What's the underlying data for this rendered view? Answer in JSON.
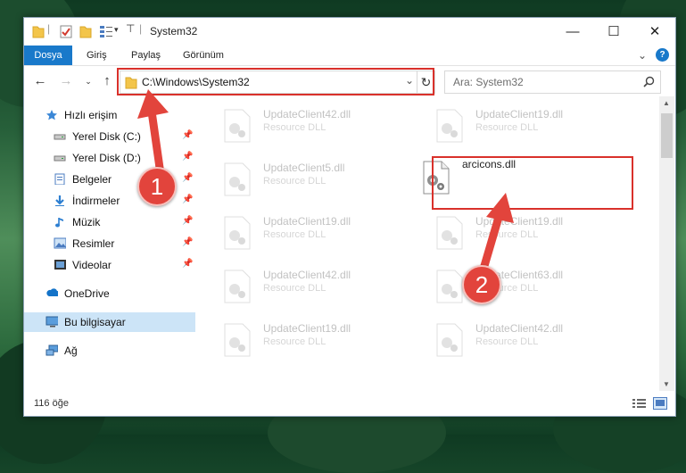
{
  "window": {
    "title": "System32",
    "minimize_label": "—",
    "maximize_label": "☐",
    "close_label": "✕"
  },
  "ribbon": {
    "tabs": [
      "Dosya",
      "Giriş",
      "Paylaş",
      "Görünüm"
    ],
    "collapse_label": "⌄",
    "help_label": "?"
  },
  "address": {
    "path": "C:\\Windows\\System32",
    "dropdown_label": "⌄",
    "refresh_label": "↻"
  },
  "search": {
    "placeholder": "Ara: System32",
    "icon": "search-icon"
  },
  "sidebar": {
    "items": [
      {
        "label": "Hızlı erişim",
        "icon": "star-icon",
        "pinned": false
      },
      {
        "label": "Yerel Disk (C:)",
        "icon": "drive-icon",
        "pinned": true
      },
      {
        "label": "Yerel Disk (D:)",
        "icon": "drive-icon",
        "pinned": true
      },
      {
        "label": "Belgeler",
        "icon": "documents-icon",
        "pinned": true
      },
      {
        "label": "İndirmeler",
        "icon": "download-icon",
        "pinned": true
      },
      {
        "label": "Müzik",
        "icon": "music-icon",
        "pinned": true
      },
      {
        "label": "Resimler",
        "icon": "pictures-icon",
        "pinned": true
      },
      {
        "label": "Videolar",
        "icon": "videos-icon",
        "pinned": true
      },
      {
        "label": "OneDrive",
        "icon": "cloud-icon",
        "pinned": false
      },
      {
        "label": "Bu bilgisayar",
        "icon": "computer-icon",
        "pinned": false
      },
      {
        "label": "Ağ",
        "icon": "network-icon",
        "pinned": false
      }
    ],
    "pin_glyph": "📌"
  },
  "files": {
    "left": [
      {
        "name": "UpdateClient42.dll",
        "type": "Resource DLL"
      },
      {
        "name": "UpdateClient5.dll",
        "type": "Resource DLL"
      },
      {
        "name": "UpdateClient19.dll",
        "type": "Resource DLL"
      },
      {
        "name": "UpdateClient42.dll",
        "type": "Resource DLL"
      },
      {
        "name": "UpdateClient19.dll",
        "type": "Resource DLL"
      }
    ],
    "right": [
      {
        "name": "UpdateClient19.dll",
        "type": "Resource DLL"
      },
      {
        "name": "arcicons.dll",
        "type": ""
      },
      {
        "name": "UpdateClient19.dll",
        "type": "Resource DLL"
      },
      {
        "name": "UpdateClient63.dll",
        "type": "Resource DLL"
      },
      {
        "name": "UpdateClient42.dll",
        "type": "Resource DLL"
      }
    ]
  },
  "status": {
    "item_count": "116 öğe"
  },
  "callouts": [
    "1",
    "2"
  ],
  "colors": {
    "accent": "#1979ca",
    "highlight": "#d9312b",
    "selected": "#cce4f7"
  }
}
